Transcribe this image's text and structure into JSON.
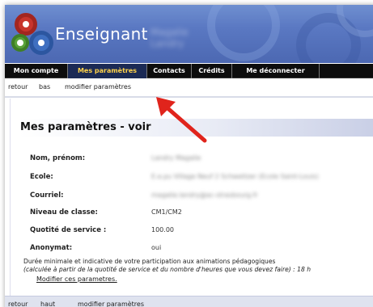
{
  "header": {
    "title": "Enseignant",
    "user_name": "Magalie Landry"
  },
  "nav": {
    "items": [
      {
        "label": "Mon compte",
        "active": false
      },
      {
        "label": "Mes paramètres",
        "active": true
      },
      {
        "label": "Contacts",
        "active": false
      },
      {
        "label": "Crédits",
        "active": false
      },
      {
        "label": "Me déconnecter",
        "active": false
      }
    ]
  },
  "toplinks": {
    "back": "retour",
    "down": "bas",
    "edit": "modifier paramètres"
  },
  "page": {
    "title": "Mes paramètres - voir"
  },
  "fields": [
    {
      "label": "Nom, prénom:",
      "value": "Landry Magalie",
      "blurred": true
    },
    {
      "label": "Ecole:",
      "value": "E.e.pu Village Neuf 2 Schweitzer (Ecole Saint-Louis)",
      "blurred": true
    },
    {
      "label": "Courriel:",
      "value": "magalie.landry@ac-strasbourg.fr",
      "blurred": true
    },
    {
      "label": "Niveau de classe:",
      "value": "CM1/CM2",
      "blurred": false
    },
    {
      "label": "Quotité de service :",
      "value": "100.00",
      "blurred": false
    },
    {
      "label": "Anonymat:",
      "value": "oui",
      "blurred": false
    }
  ],
  "notes": {
    "line1": "Durée minimale et indicative de votre participation aux animations pédagogiques",
    "line2": "(calculée à partir de la quotité de service et du nombre d'heures que vous devez faire) : 18 h",
    "edit_link": "Modifier ces parametres."
  },
  "bottomlinks": {
    "back": "retour",
    "up": "haut",
    "edit": "modifier paramètres"
  },
  "colors": {
    "banner": "#5a78c2",
    "nav_bg": "#0d0d0d",
    "nav_active_text": "#ffd24a",
    "arrow": "#e0241c"
  }
}
